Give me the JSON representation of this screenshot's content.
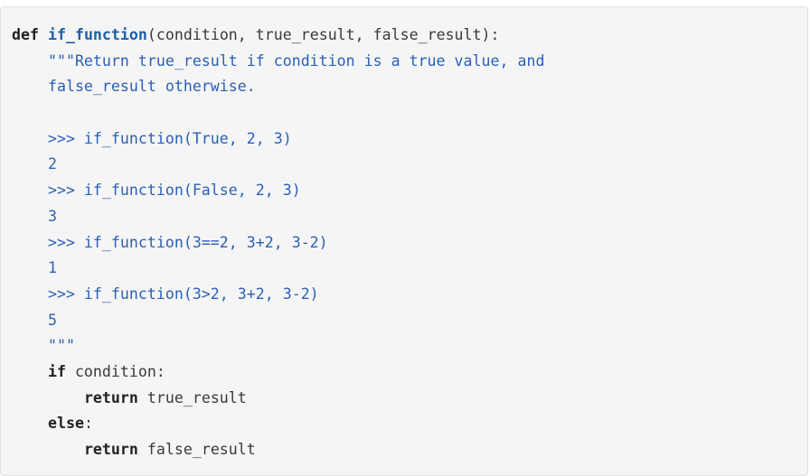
{
  "code": {
    "line1": {
      "kw": "def",
      "space": " ",
      "fn": "if_function",
      "rest": "(condition, true_result, false_result):"
    },
    "line2": {
      "indent": "    ",
      "text": "\"\"\"Return true_result if condition is a true value, and"
    },
    "line3": {
      "indent": "    ",
      "text": "false_result otherwise."
    },
    "line4": {
      "text": ""
    },
    "line5": {
      "indent": "    ",
      "text": ">>> if_function(True, 2, 3)"
    },
    "line6": {
      "indent": "    ",
      "text": "2"
    },
    "line7": {
      "indent": "    ",
      "text": ">>> if_function(False, 2, 3)"
    },
    "line8": {
      "indent": "    ",
      "text": "3"
    },
    "line9": {
      "indent": "    ",
      "text": ">>> if_function(3==2, 3+2, 3-2)"
    },
    "line10": {
      "indent": "    ",
      "text": "1"
    },
    "line11": {
      "indent": "    ",
      "text": ">>> if_function(3>2, 3+2, 3-2)"
    },
    "line12": {
      "indent": "    ",
      "text": "5"
    },
    "line13": {
      "indent": "    ",
      "text": "\"\"\""
    },
    "line14": {
      "indent": "    ",
      "kw": "if",
      "rest": " condition:"
    },
    "line15": {
      "indent": "        ",
      "kw": "return",
      "rest": " true_result"
    },
    "line16": {
      "indent": "    ",
      "kw": "else",
      "rest": ":"
    },
    "line17": {
      "indent": "        ",
      "kw": "return",
      "rest": " false_result"
    }
  }
}
